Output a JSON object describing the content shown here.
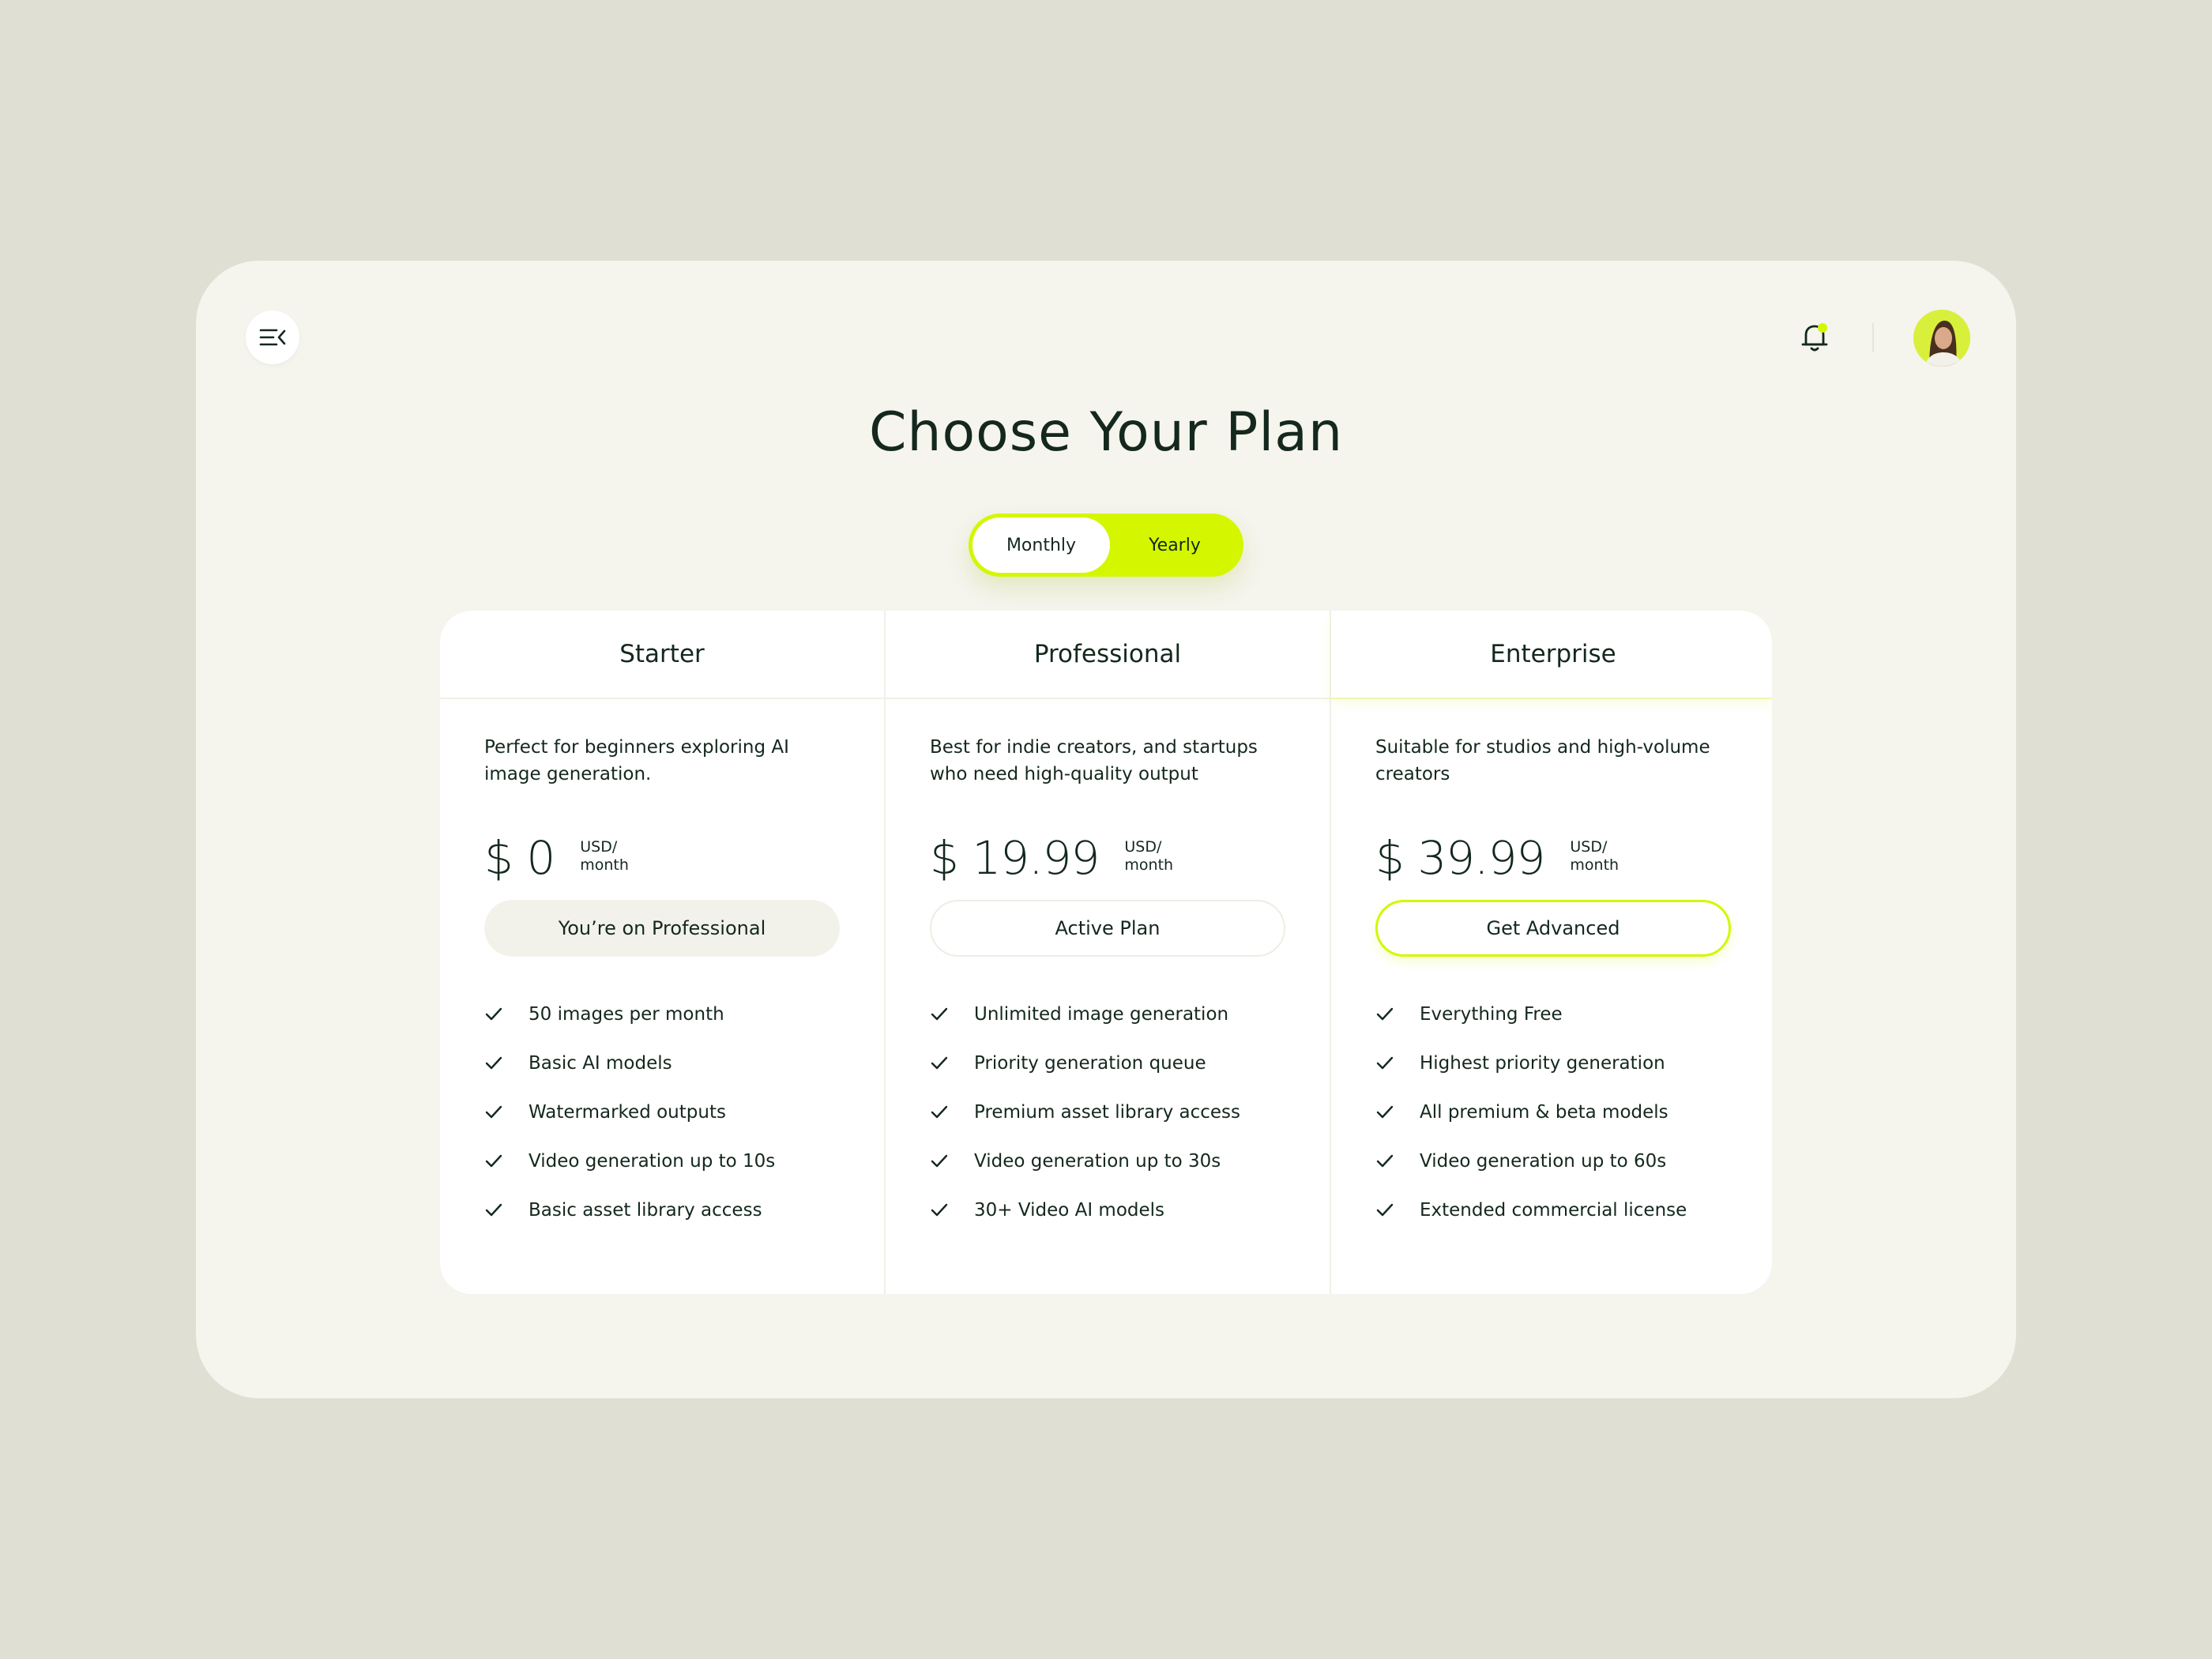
{
  "header": {
    "menu_icon": "menu-collapse-icon",
    "notification_icon": "bell-icon",
    "avatar_alt": "user-avatar"
  },
  "title": "Choose Your Plan",
  "billing_toggle": {
    "options": [
      "Monthly",
      "Yearly"
    ],
    "selected": "Monthly"
  },
  "colors": {
    "accent": "#d4f700",
    "text": "#14281d",
    "page_background": "#e0dfd4",
    "window_background": "#f5f4ed"
  },
  "plans": [
    {
      "name": "Starter",
      "description": "Perfect for beginners exploring AI image generation.",
      "price": "$ 0",
      "unit_line1": "USD/",
      "unit_line2": "month",
      "cta": "You’re on Professional",
      "features": [
        "50 images per month",
        "Basic AI models",
        "Watermarked outputs",
        "Video generation up to 10s",
        "Basic asset library access"
      ]
    },
    {
      "name": "Professional",
      "description": "Best for indie creators, and startups who need high-quality output",
      "price": "$ 19.99",
      "unit_line1": "USD/",
      "unit_line2": "month",
      "cta": "Active Plan",
      "features": [
        "Unlimited image generation",
        "Priority generation queue",
        "Premium asset library access",
        "Video generation up to 30s",
        "30+ Video AI models"
      ]
    },
    {
      "name": "Enterprise",
      "description": "Suitable for studios and high-volume creators",
      "price": "$ 39.99",
      "unit_line1": "USD/",
      "unit_line2": "month",
      "cta": "Get Advanced",
      "features": [
        "Everything Free",
        "Highest priority generation",
        "All premium & beta models",
        "Video generation up to 60s",
        "Extended commercial license"
      ]
    }
  ]
}
